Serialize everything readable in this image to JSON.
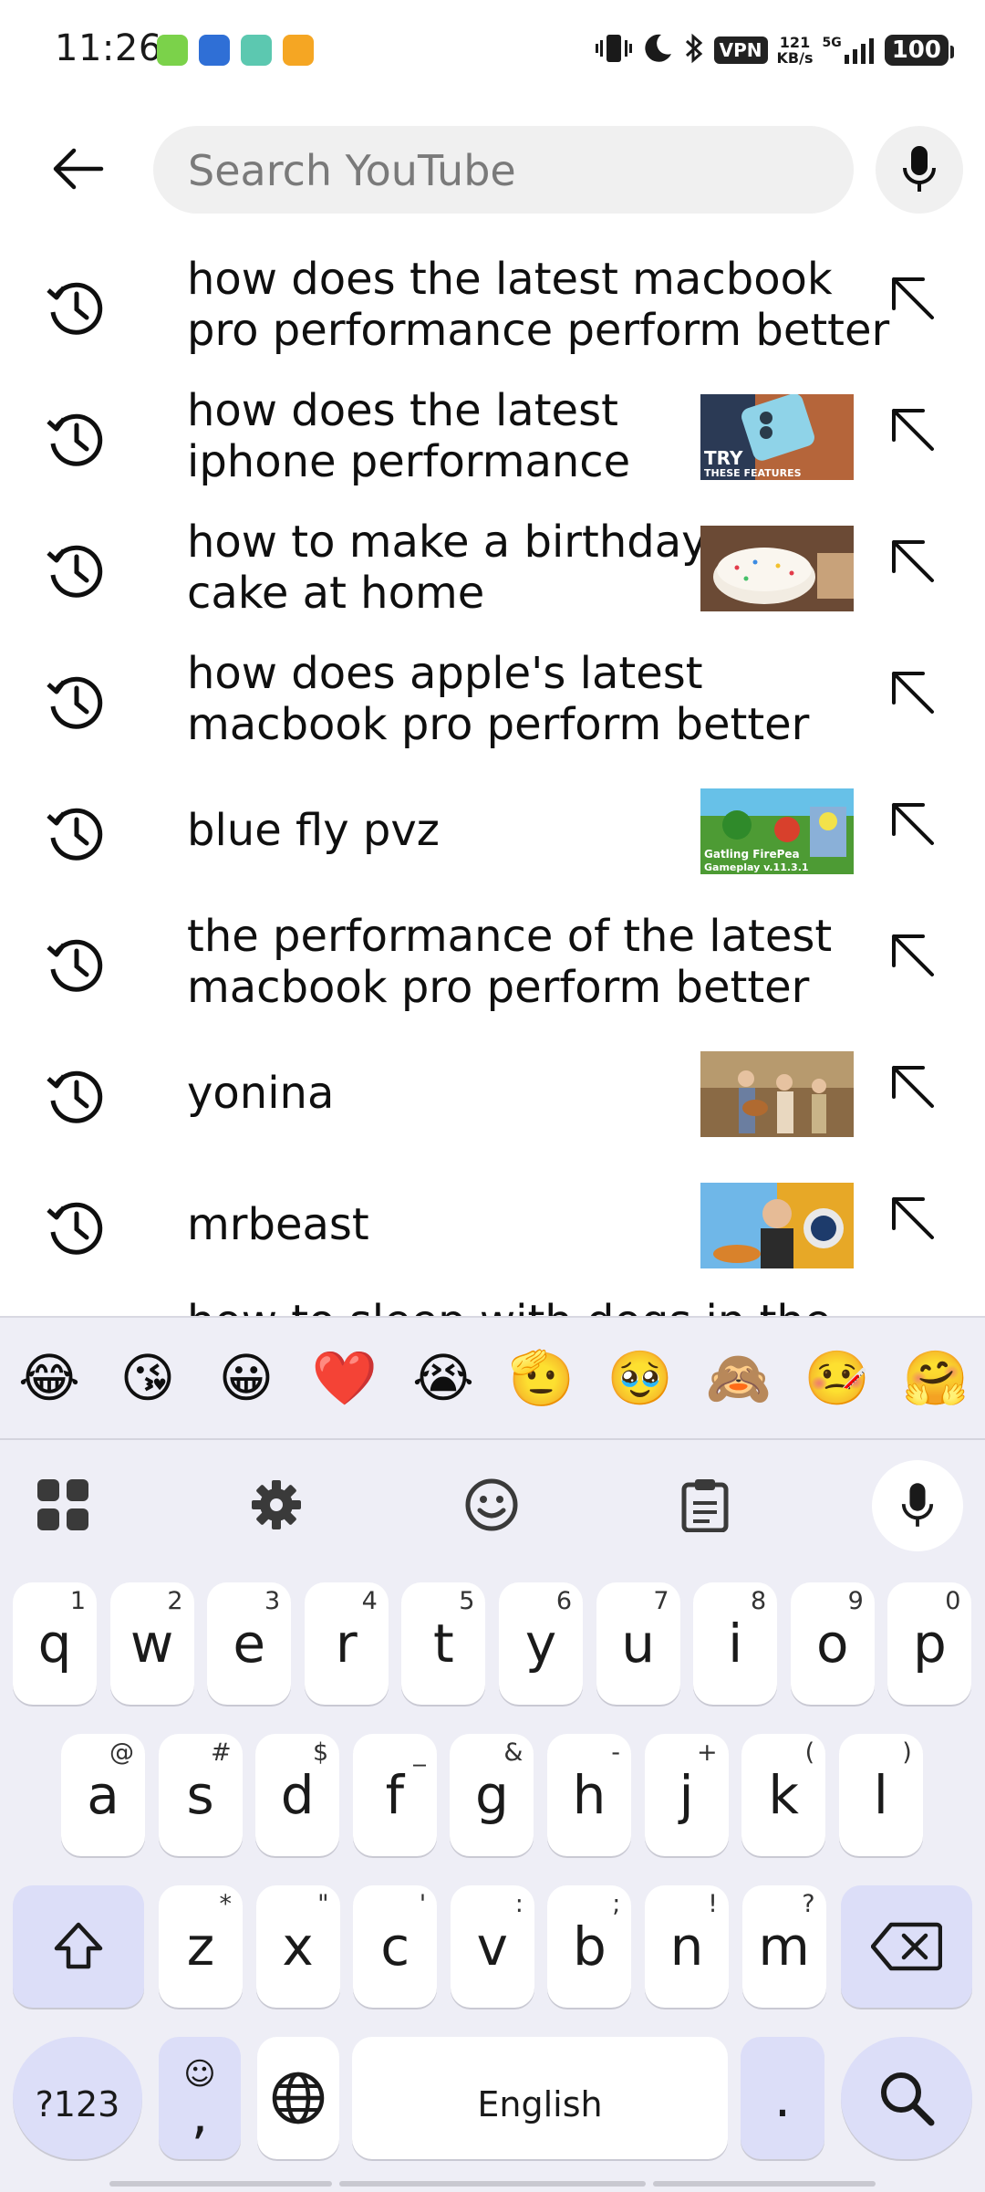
{
  "status_bar": {
    "time": "11:26",
    "vpn": "VPN",
    "net_speed_value": "121",
    "net_speed_unit": "KB/s",
    "network": "5G",
    "battery": "100"
  },
  "search": {
    "placeholder": "Search YouTube",
    "value": ""
  },
  "suggestions": [
    {
      "text": "how does the latest macbook pro performance perform better",
      "line1": "how does the latest macbook",
      "line2": "pro performance perform better",
      "thumb": null
    },
    {
      "text": "how does the latest iphone performance",
      "line1": "how does the latest",
      "line2": "iphone performance",
      "thumb": "iphone",
      "thumb_caption1": "TRY",
      "thumb_caption2": "THESE FEATURES"
    },
    {
      "text": "how to make a birthday cake at home",
      "line1": "how to make a birthday",
      "line2": "cake at home",
      "thumb": "cake"
    },
    {
      "text": "how does apple's latest macbook pro perform better",
      "line1": "how does apple's latest",
      "line2": "macbook pro perform better",
      "thumb": null
    },
    {
      "text": "blue fly pvz",
      "line1": "blue fly pvz",
      "line2": "",
      "thumb": "pvz",
      "thumb_caption1": "Gatling FirePea",
      "thumb_caption2": "Gameplay v.11.3.1"
    },
    {
      "text": "the performance of the latest macbook pro perform better",
      "line1": "the performance of the latest",
      "line2": "macbook pro perform better",
      "thumb": null
    },
    {
      "text": "yonina",
      "line1": "yonina",
      "line2": "",
      "thumb": "yonina"
    },
    {
      "text": "mrbeast",
      "line1": "mrbeast",
      "line2": "",
      "thumb": "mrbeast"
    }
  ],
  "partial_suggestion": "how to sleep with dogs in the",
  "keyboard": {
    "emojis": [
      "😂",
      "😘",
      "😀",
      "❤️",
      "😭",
      "🫡",
      "🥹",
      "🙈",
      "🤒",
      "🤗"
    ],
    "row1": [
      {
        "label": "q",
        "hint": "1"
      },
      {
        "label": "w",
        "hint": "2"
      },
      {
        "label": "e",
        "hint": "3"
      },
      {
        "label": "r",
        "hint": "4"
      },
      {
        "label": "t",
        "hint": "5"
      },
      {
        "label": "y",
        "hint": "6"
      },
      {
        "label": "u",
        "hint": "7"
      },
      {
        "label": "i",
        "hint": "8"
      },
      {
        "label": "o",
        "hint": "9"
      },
      {
        "label": "p",
        "hint": "0"
      }
    ],
    "row2": [
      {
        "label": "a",
        "hint": "@"
      },
      {
        "label": "s",
        "hint": "#"
      },
      {
        "label": "d",
        "hint": "$"
      },
      {
        "label": "f",
        "hint": "_"
      },
      {
        "label": "g",
        "hint": "&"
      },
      {
        "label": "h",
        "hint": "-"
      },
      {
        "label": "j",
        "hint": "+"
      },
      {
        "label": "k",
        "hint": "("
      },
      {
        "label": "l",
        "hint": ")"
      }
    ],
    "row3": [
      {
        "label": "z",
        "hint": "*"
      },
      {
        "label": "x",
        "hint": "\""
      },
      {
        "label": "c",
        "hint": "'"
      },
      {
        "label": "v",
        "hint": ":"
      },
      {
        "label": "b",
        "hint": ";"
      },
      {
        "label": "n",
        "hint": "!"
      },
      {
        "label": "m",
        "hint": "?"
      }
    ],
    "symbols_label": "?123",
    "comma_label": ",",
    "space_label": "English",
    "period_label": "."
  },
  "colors": {
    "keyboard_bg": "#eeeef6",
    "special_key": "#dcdef8",
    "search_bg": "#f0f0f0"
  }
}
